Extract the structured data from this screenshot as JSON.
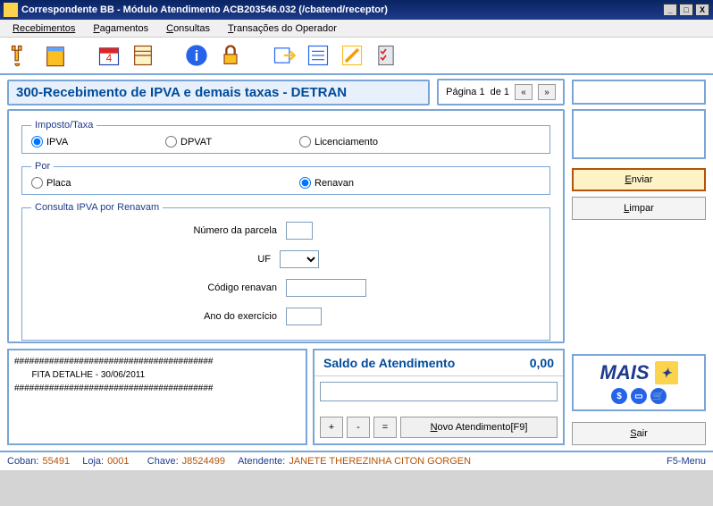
{
  "window": {
    "title": "Correspondente BB - Módulo Atendimento ACB203546.032 (/cbatend/receptor)"
  },
  "menu": {
    "items": [
      "Recebimentos",
      "Pagamentos",
      "Consultas",
      "Transações do Operador"
    ]
  },
  "page": {
    "title": "300-Recebimento de IPVA e demais taxas - DETRAN",
    "pager_label": "Página 1",
    "pager_of": "de 1"
  },
  "form": {
    "imposto_legend": "Imposto/Taxa",
    "imposto_opts": {
      "ipva": "IPVA",
      "dpvat": "DPVAT",
      "licenciamento": "Licenciamento"
    },
    "por_legend": "Por",
    "por_opts": {
      "placa": "Placa",
      "renavan": "Renavan"
    },
    "consulta_legend": "Consulta IPVA por Renavam",
    "fields": {
      "numero_parcela": "Número da parcela",
      "uf": "UF",
      "codigo_renavan": "Código renavan",
      "ano_exercicio": "Ano do exercício"
    },
    "values": {
      "numero_parcela": "",
      "uf": "",
      "codigo_renavan": "",
      "ano_exercicio": ""
    }
  },
  "receipt": {
    "line1": "########################################",
    "line2": "       FITA DETALHE - 30/06/2011",
    "line3": "########################################"
  },
  "saldo": {
    "title": "Saldo de Atendimento",
    "value": "0,00",
    "novo": "Novo Atendimento[F9]",
    "plus": "+",
    "minus": "-",
    "eq": "="
  },
  "actions": {
    "enviar": "Enviar",
    "limpar": "Limpar",
    "sair": "Sair"
  },
  "brand": {
    "mais": "MAIS"
  },
  "status": {
    "coban_l": "Coban:",
    "coban_v": "55491",
    "loja_l": "Loja:",
    "loja_v": "0001",
    "chave_l": "Chave:",
    "chave_v": "J8524499",
    "atendente_l": "Atendente:",
    "atendente_v": "JANETE THEREZINHA CITON GORGEN",
    "f5": "F5-Menu"
  }
}
